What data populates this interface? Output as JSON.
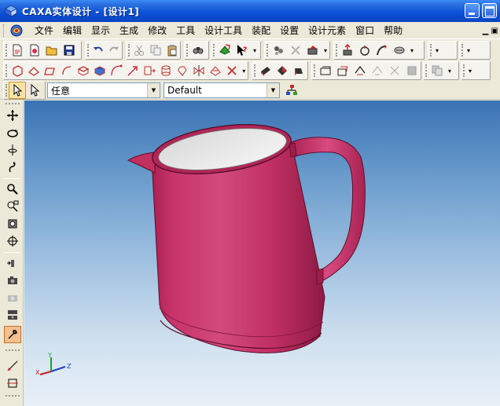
{
  "window": {
    "title": "CAXA实体设计 - [设计1]"
  },
  "menubar": {
    "items": [
      "文件",
      "编辑",
      "显示",
      "生成",
      "修改",
      "工具",
      "设计工具",
      "装配",
      "设置",
      "设计元素",
      "窗口",
      "帮助"
    ]
  },
  "selection": {
    "filter_value": "任意",
    "style_value": "Default"
  },
  "triad": {
    "x_label": "X",
    "y_label": "Y",
    "z_label": "Z"
  },
  "colors": {
    "model": "#c2305f",
    "model_dark": "#8e1a44",
    "model_light": "#d85a85",
    "interior": "#ececec",
    "title_bar": "#0a50d8"
  },
  "icons": {
    "toolbar1": [
      "new-doc-icon",
      "new-design-icon",
      "open-icon",
      "save-icon",
      "undo-icon",
      "redo-icon",
      "cut-icon",
      "copy-icon",
      "paste-icon",
      "find-icon",
      "send-icon",
      "help-pointer-icon",
      "render-icon",
      "material-icon",
      "paint-icon",
      "extrude-icon",
      "revolve-icon",
      "sweep-icon",
      "loft-icon"
    ],
    "toolbar2": [
      "box-view-icon",
      "sketch-icon",
      "face-icon",
      "edge-icon",
      "solid-icon",
      "curve-icon",
      "arrow-icon",
      "cut-plane-icon",
      "cylinder-icon",
      "rotate-part-icon",
      "mirror-icon",
      "trim-icon",
      "light-icon",
      "shading-icon",
      "wireframe-icon",
      "section-icon",
      "pattern-icon",
      "drop-icon"
    ],
    "left_toolbar": [
      "move-icon",
      "orbit-icon",
      "spin-icon",
      "pan-icon",
      "zoom-icon",
      "zoom-window-icon",
      "view-fit-icon",
      "target-icon",
      "walk-icon",
      "camera-icon",
      "camera-alt-icon",
      "camera-set-icon",
      "wrench-icon",
      "measure-icon",
      "sketch-plane-icon"
    ]
  }
}
